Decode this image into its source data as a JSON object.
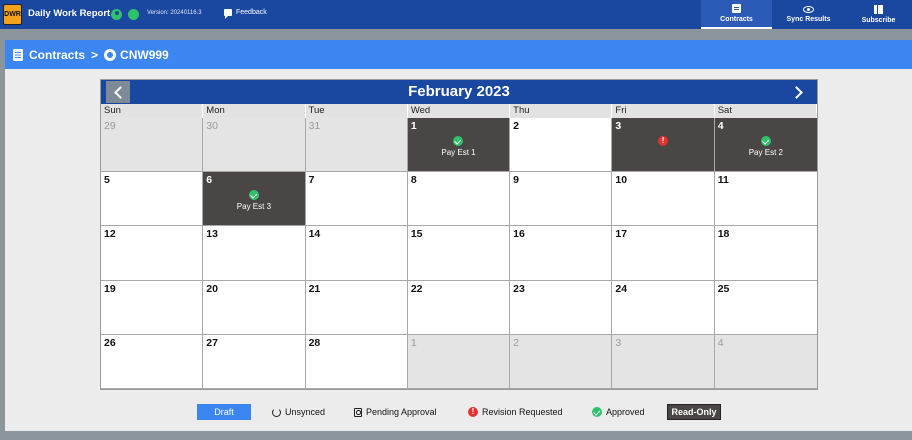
{
  "app": {
    "logo_text": "DWR",
    "title": "Daily Work Report",
    "version": "Version: 20240116.3",
    "feedback_label": "Feedback"
  },
  "nav": {
    "tabs": [
      {
        "label": "Contracts",
        "icon": "document-icon",
        "active": true
      },
      {
        "label": "Sync Results",
        "icon": "eye-icon",
        "active": false
      },
      {
        "label": "Subscribe",
        "icon": "books-icon",
        "active": false
      }
    ]
  },
  "breadcrumb": {
    "root": "Contracts",
    "separator": ">",
    "current": "CNW999"
  },
  "calendar": {
    "month_title": "February 2023",
    "weekdays": [
      "Sun",
      "Mon",
      "Tue",
      "Wed",
      "Thu",
      "Fri",
      "Sat"
    ],
    "days": [
      {
        "num": "29",
        "state": "other"
      },
      {
        "num": "30",
        "state": "other"
      },
      {
        "num": "31",
        "state": "other"
      },
      {
        "num": "1",
        "state": "readonly",
        "status": "approved",
        "label": "Pay Est 1"
      },
      {
        "num": "2",
        "state": "current"
      },
      {
        "num": "3",
        "state": "readonly",
        "status": "revision",
        "label": ""
      },
      {
        "num": "4",
        "state": "readonly",
        "status": "approved",
        "label": "Pay Est 2"
      },
      {
        "num": "5",
        "state": "current"
      },
      {
        "num": "6",
        "state": "readonly",
        "status": "approved",
        "label": "Pay Est 3"
      },
      {
        "num": "7",
        "state": "current"
      },
      {
        "num": "8",
        "state": "current"
      },
      {
        "num": "9",
        "state": "current"
      },
      {
        "num": "10",
        "state": "current"
      },
      {
        "num": "11",
        "state": "current"
      },
      {
        "num": "12",
        "state": "current"
      },
      {
        "num": "13",
        "state": "current"
      },
      {
        "num": "14",
        "state": "current"
      },
      {
        "num": "15",
        "state": "current"
      },
      {
        "num": "16",
        "state": "current"
      },
      {
        "num": "17",
        "state": "current"
      },
      {
        "num": "18",
        "state": "current"
      },
      {
        "num": "19",
        "state": "current"
      },
      {
        "num": "20",
        "state": "current"
      },
      {
        "num": "21",
        "state": "current"
      },
      {
        "num": "22",
        "state": "current"
      },
      {
        "num": "23",
        "state": "current"
      },
      {
        "num": "24",
        "state": "current"
      },
      {
        "num": "25",
        "state": "current"
      },
      {
        "num": "26",
        "state": "current"
      },
      {
        "num": "27",
        "state": "current"
      },
      {
        "num": "28",
        "state": "current"
      },
      {
        "num": "1",
        "state": "other"
      },
      {
        "num": "2",
        "state": "other"
      },
      {
        "num": "3",
        "state": "other"
      },
      {
        "num": "4",
        "state": "other"
      }
    ]
  },
  "legend": {
    "draft": "Draft",
    "unsynced": "Unsynced",
    "pending": "Pending Approval",
    "revision": "Revision Requested",
    "approved": "Approved",
    "readonly": "Read-Only"
  },
  "colors": {
    "topbar": "#1a47a0",
    "accent_blue": "#3b86f0",
    "readonly_cell": "#4a4645",
    "approved_green": "#2fc26b",
    "revision_red": "#e33232"
  }
}
